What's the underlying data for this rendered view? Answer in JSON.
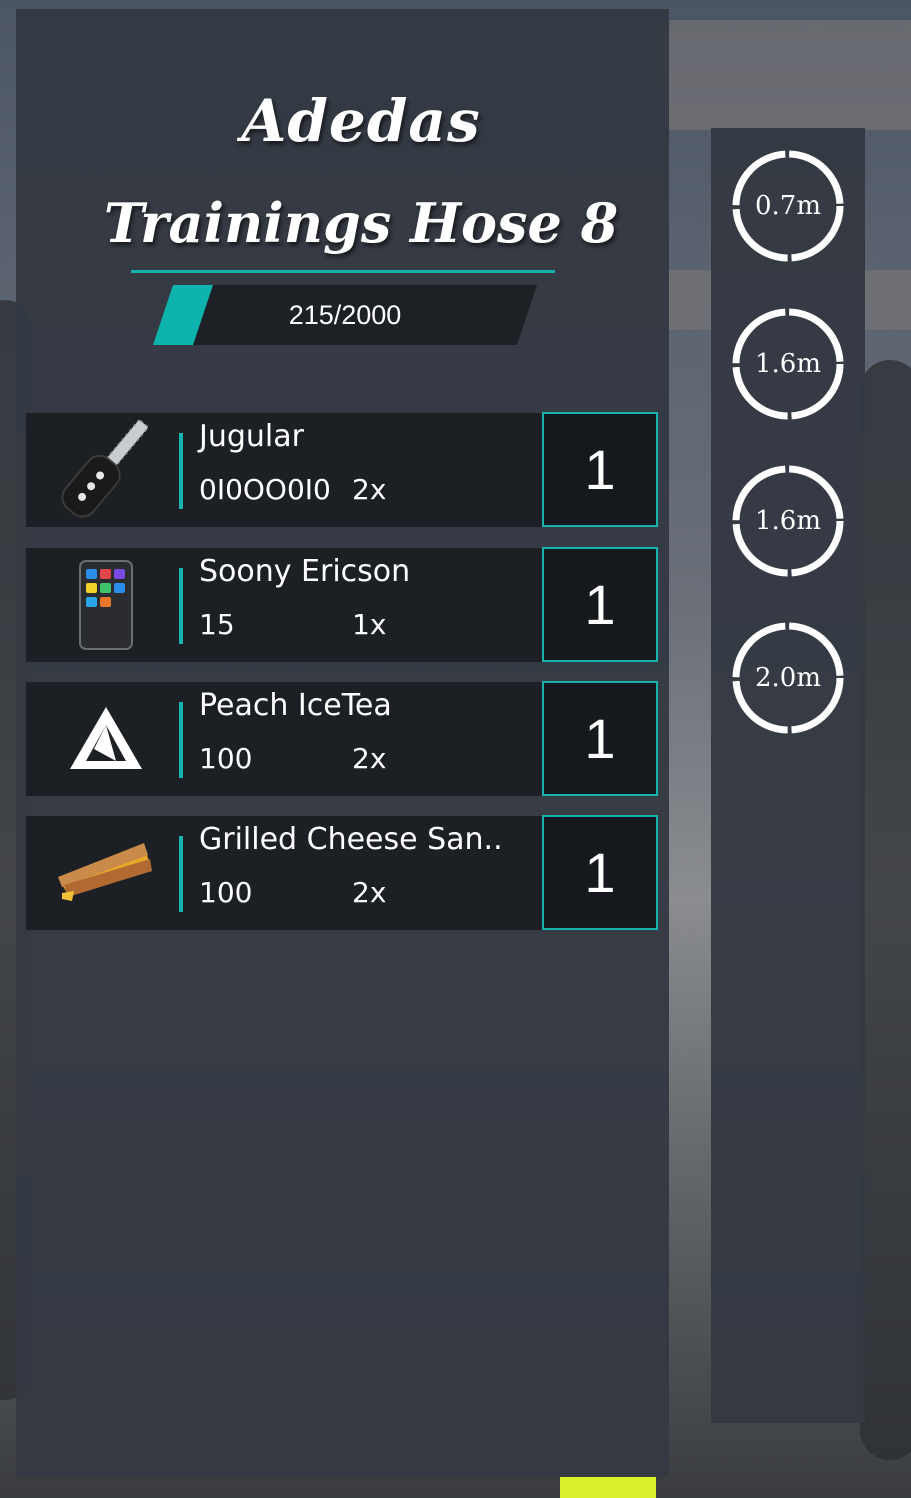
{
  "inventory": {
    "title": "Adedas",
    "subtitle": "Trainings Hose 8",
    "weight": {
      "text": "215/2000",
      "fill_fraction": 0.1075
    },
    "accent_color": "#16b2ad",
    "items": [
      {
        "name": "Jugular",
        "meta1": "0I0OO0I0",
        "meta2": "2x",
        "quantity": "1",
        "icon": "car-key-icon"
      },
      {
        "name": "Soony Ericson",
        "meta1": "15",
        "meta2": "1x",
        "quantity": "1",
        "icon": "phone-icon"
      },
      {
        "name": "Peach IceTea",
        "meta1": "100",
        "meta2": "2x",
        "quantity": "1",
        "icon": "triangle-logo-icon"
      },
      {
        "name": "Grilled Cheese San..",
        "meta1": "100",
        "meta2": "2x",
        "quantity": "1",
        "icon": "sandwich-icon"
      }
    ]
  },
  "timers": [
    {
      "label": "0.7m"
    },
    {
      "label": "1.6m"
    },
    {
      "label": "1.6m"
    },
    {
      "label": "2.0m"
    }
  ]
}
